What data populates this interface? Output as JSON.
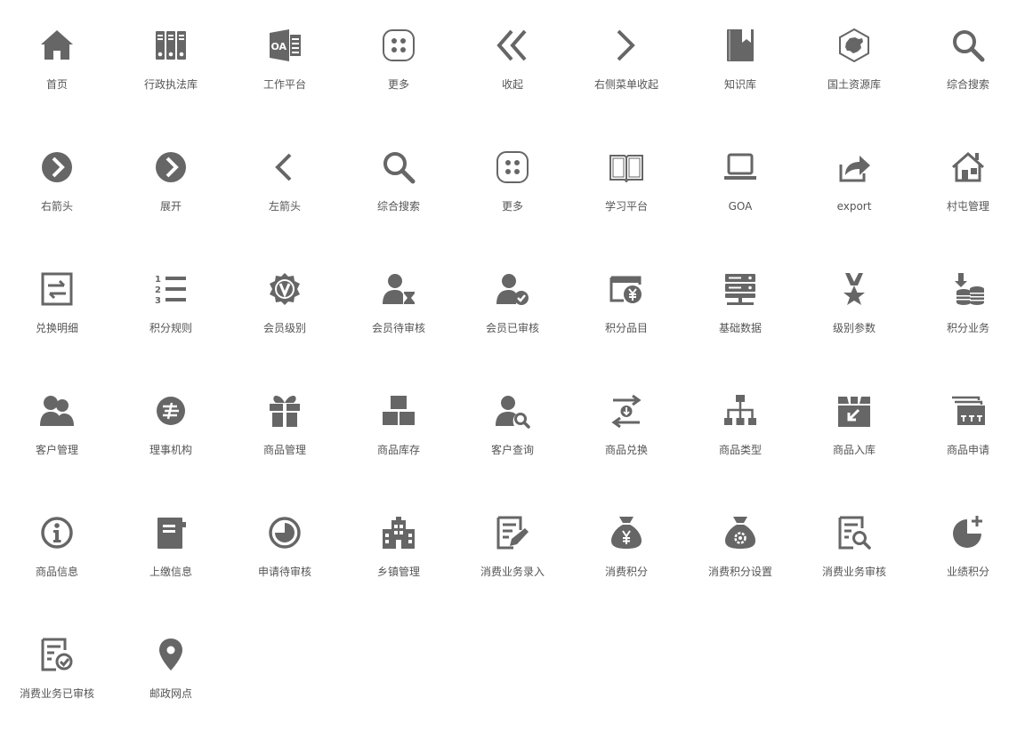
{
  "icon_color": "#666666",
  "label_color": "#555555",
  "icons": [
    {
      "label": "首页",
      "icon": "home-icon"
    },
    {
      "label": "行政执法库",
      "icon": "binders-icon"
    },
    {
      "label": "工作平台",
      "icon": "outlook-oa-icon"
    },
    {
      "label": "更多",
      "icon": "more-dots-icon"
    },
    {
      "label": "收起",
      "icon": "double-chevron-left-icon"
    },
    {
      "label": "右侧菜单收起",
      "icon": "chevron-right-icon"
    },
    {
      "label": "知识库",
      "icon": "bookmark-book-icon"
    },
    {
      "label": "国土资源库",
      "icon": "china-map-hexagon-icon"
    },
    {
      "label": "综合搜索",
      "icon": "search-icon"
    },
    {
      "label": "右箭头",
      "icon": "circle-arrow-right-icon"
    },
    {
      "label": "展开",
      "icon": "circle-arrow-right-icon"
    },
    {
      "label": "左箭头",
      "icon": "chevron-left-icon"
    },
    {
      "label": "综合搜索",
      "icon": "search-icon"
    },
    {
      "label": "更多",
      "icon": "more-dots-icon"
    },
    {
      "label": "学习平台",
      "icon": "open-book-icon"
    },
    {
      "label": "GOA",
      "icon": "laptop-icon"
    },
    {
      "label": "export",
      "icon": "share-export-icon"
    },
    {
      "label": "村屯管理",
      "icon": "village-house-icon"
    },
    {
      "label": "兑换明细",
      "icon": "exchange-box-icon"
    },
    {
      "label": "积分规则",
      "icon": "numbered-list-icon"
    },
    {
      "label": "会员级别",
      "icon": "vip-badge-icon"
    },
    {
      "label": "会员待审核",
      "icon": "user-hourglass-icon"
    },
    {
      "label": "会员已审核",
      "icon": "user-check-icon"
    },
    {
      "label": "积分品目",
      "icon": "yen-window-icon"
    },
    {
      "label": "基础数据",
      "icon": "server-icon"
    },
    {
      "label": "级别参数",
      "icon": "medal-star-icon"
    },
    {
      "label": "积分业务",
      "icon": "coins-stack-icon"
    },
    {
      "label": "客户管理",
      "icon": "users-icon"
    },
    {
      "label": "理事机构",
      "icon": "china-post-icon"
    },
    {
      "label": "商品管理",
      "icon": "gift-icon"
    },
    {
      "label": "商品库存",
      "icon": "boxes-stack-icon"
    },
    {
      "label": "客户查询",
      "icon": "user-search-icon"
    },
    {
      "label": "商品兑换",
      "icon": "swap-arrows-icon"
    },
    {
      "label": "商品类型",
      "icon": "hierarchy-icon"
    },
    {
      "label": "商品入库",
      "icon": "box-inbound-icon"
    },
    {
      "label": "商品申请",
      "icon": "stacked-windows-icon"
    },
    {
      "label": "商品信息",
      "icon": "info-circle-icon"
    },
    {
      "label": "上缴信息",
      "icon": "notebook-icon"
    },
    {
      "label": "申请待审核",
      "icon": "pie-clock-icon"
    },
    {
      "label": "乡镇管理",
      "icon": "building-icon"
    },
    {
      "label": "消费业务录入",
      "icon": "document-pen-icon"
    },
    {
      "label": "消费积分",
      "icon": "money-bag-yen-icon"
    },
    {
      "label": "消费积分设置",
      "icon": "money-bag-gear-icon"
    },
    {
      "label": "消费业务审核",
      "icon": "document-search-icon"
    },
    {
      "label": "业绩积分",
      "icon": "pie-plus-icon"
    },
    {
      "label": "消费业务已审核",
      "icon": "document-check-icon"
    },
    {
      "label": "邮政网点",
      "icon": "location-pin-icon"
    }
  ]
}
